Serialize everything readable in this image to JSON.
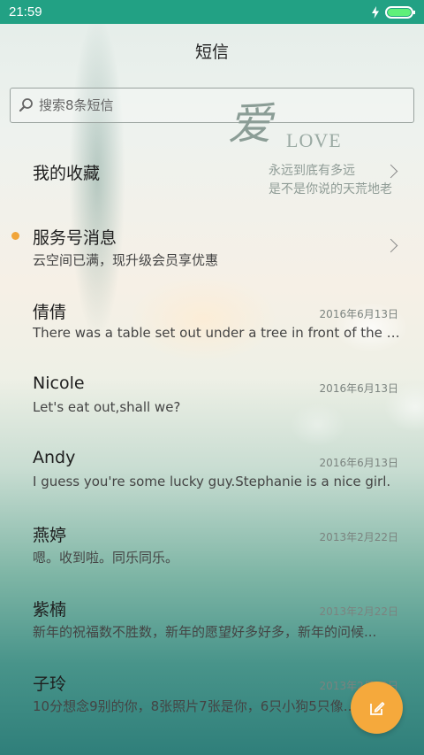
{
  "status_bar": {
    "time": "21:59",
    "charging_icon": "lightning-icon",
    "battery_level": 1.0,
    "battery_color": "#5ef07a"
  },
  "header": {
    "title": "短信"
  },
  "search": {
    "placeholder": "搜索8条短信"
  },
  "decoration": {
    "char": "爱",
    "word": "LOVE",
    "line1": "永远到底有多远",
    "line2": "是不是你说的天荒地老"
  },
  "threads": [
    {
      "name": "我的收藏",
      "preview": "",
      "date": "",
      "has_chevron": true,
      "unread": false
    },
    {
      "name": "服务号消息",
      "preview": "云空间已满，现升级会员享优惠",
      "date": "",
      "has_chevron": true,
      "unread": true
    },
    {
      "name": "倩倩",
      "preview": "There was a table set out under a tree in front of the ho...",
      "date": "2016年6月13日",
      "has_chevron": false,
      "unread": false
    },
    {
      "name": "Nicole",
      "preview": "Let's eat out,shall we?",
      "date": "2016年6月13日",
      "has_chevron": false,
      "unread": false
    },
    {
      "name": "Andy",
      "preview": "I guess you're some lucky guy.Stephanie is a nice girl.",
      "date": "2016年6月13日",
      "has_chevron": false,
      "unread": false
    },
    {
      "name": "燕婷",
      "preview": "嗯。收到啦。同乐同乐。",
      "date": "2013年2月22日",
      "has_chevron": false,
      "unread": false
    },
    {
      "name": "紫楠",
      "preview": "新年的祝福数不胜数，新年的愿望好多好多，新年的问候...",
      "date": "2013年2月22日",
      "has_chevron": false,
      "unread": false
    },
    {
      "name": "子玲",
      "preview": "10分想念9别的你，8张照片7张是你，6只小狗5只像...",
      "date": "2013年2月22日",
      "has_chevron": false,
      "unread": false
    }
  ],
  "fab": {
    "icon": "compose-icon",
    "color": "#f5a93c"
  },
  "colors": {
    "status_bar": "#22a184",
    "unread_dot": "#f1a53a"
  }
}
